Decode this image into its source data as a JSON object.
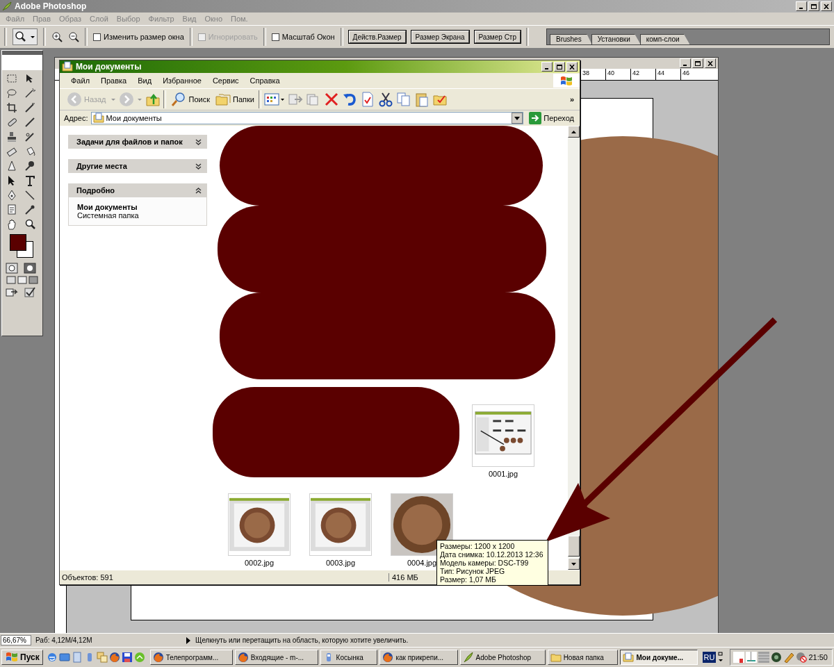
{
  "app": {
    "title": "Adobe Photoshop",
    "menu": [
      "Файл",
      "Прав",
      "Образ",
      "Слой",
      "Выбор",
      "Фильтр",
      "Вид",
      "Окно",
      "Пом."
    ]
  },
  "options": {
    "checkboxes": [
      {
        "label": "Изменить размер окна",
        "checked": false,
        "disabled": false
      },
      {
        "label": "Игнорировать",
        "checked": false,
        "disabled": true
      },
      {
        "label": "Масштаб Окон",
        "checked": false,
        "disabled": false
      }
    ],
    "buttons": [
      "Действ.Размер",
      "Размер Экрана",
      "Размер Стр"
    ]
  },
  "palette_tabs": [
    "Brushes",
    "Установки",
    "комп-слои"
  ],
  "document": {
    "ruler_numbers": [
      "38",
      "40",
      "42",
      "44",
      "46"
    ]
  },
  "explorer": {
    "title": "Мои документы",
    "menu": [
      "Файл",
      "Правка",
      "Вид",
      "Избранное",
      "Сервис",
      "Справка"
    ],
    "toolbar": {
      "back": "Назад",
      "search": "Поиск",
      "folders": "Папки",
      "more": "»"
    },
    "address": {
      "label": "Адрес:",
      "value": "Мои документы",
      "go": "Переход"
    },
    "panels": [
      {
        "title": "Задачи для файлов и папок",
        "expanded": false
      },
      {
        "title": "Другие места",
        "expanded": false
      },
      {
        "title": "Подробно",
        "expanded": true,
        "name": "Мои документы",
        "description": "Системная папка"
      }
    ],
    "files": [
      {
        "name": "0001.jpg",
        "kind": "screenshot"
      },
      {
        "name": "0002.jpg",
        "kind": "medal-screenshot"
      },
      {
        "name": "0003.jpg",
        "kind": "medal-screenshot"
      },
      {
        "name": "0004.jpg",
        "kind": "medal-photo"
      }
    ],
    "status": {
      "objects": "Объектов: 591",
      "size": "416 МБ"
    }
  },
  "tooltip": {
    "lines": [
      "Размеры: 1200 x 1200",
      "Дата снимка: 10.12.2013 12:36",
      "Модель камеры: DSC-T99",
      "Тип: Рисунок JPEG",
      "Размер: 1,07 МБ"
    ]
  },
  "status_bar": {
    "zoom": "66,67%",
    "memory": "Раб: 4,12M/4,12M",
    "hint": "Щелкнуть или перетащить на область, которую хотите увеличить."
  },
  "taskbar": {
    "start": "Пуск",
    "tasks": [
      {
        "label": "Телепрограмм...",
        "kind": "browser",
        "selected": false
      },
      {
        "label": "Входящие - m-...",
        "kind": "browser",
        "selected": false
      },
      {
        "label": "Косынка",
        "kind": "app",
        "selected": false
      },
      {
        "label": "как прикрепи...",
        "kind": "browser",
        "selected": false
      },
      {
        "label": "Adobe Photoshop",
        "kind": "feather",
        "selected": false
      },
      {
        "label": "Новая папка",
        "kind": "folder",
        "selected": false
      },
      {
        "label": "Мои докуме...",
        "kind": "docs",
        "selected": true
      }
    ],
    "language": "RU",
    "clock": "21:50"
  }
}
